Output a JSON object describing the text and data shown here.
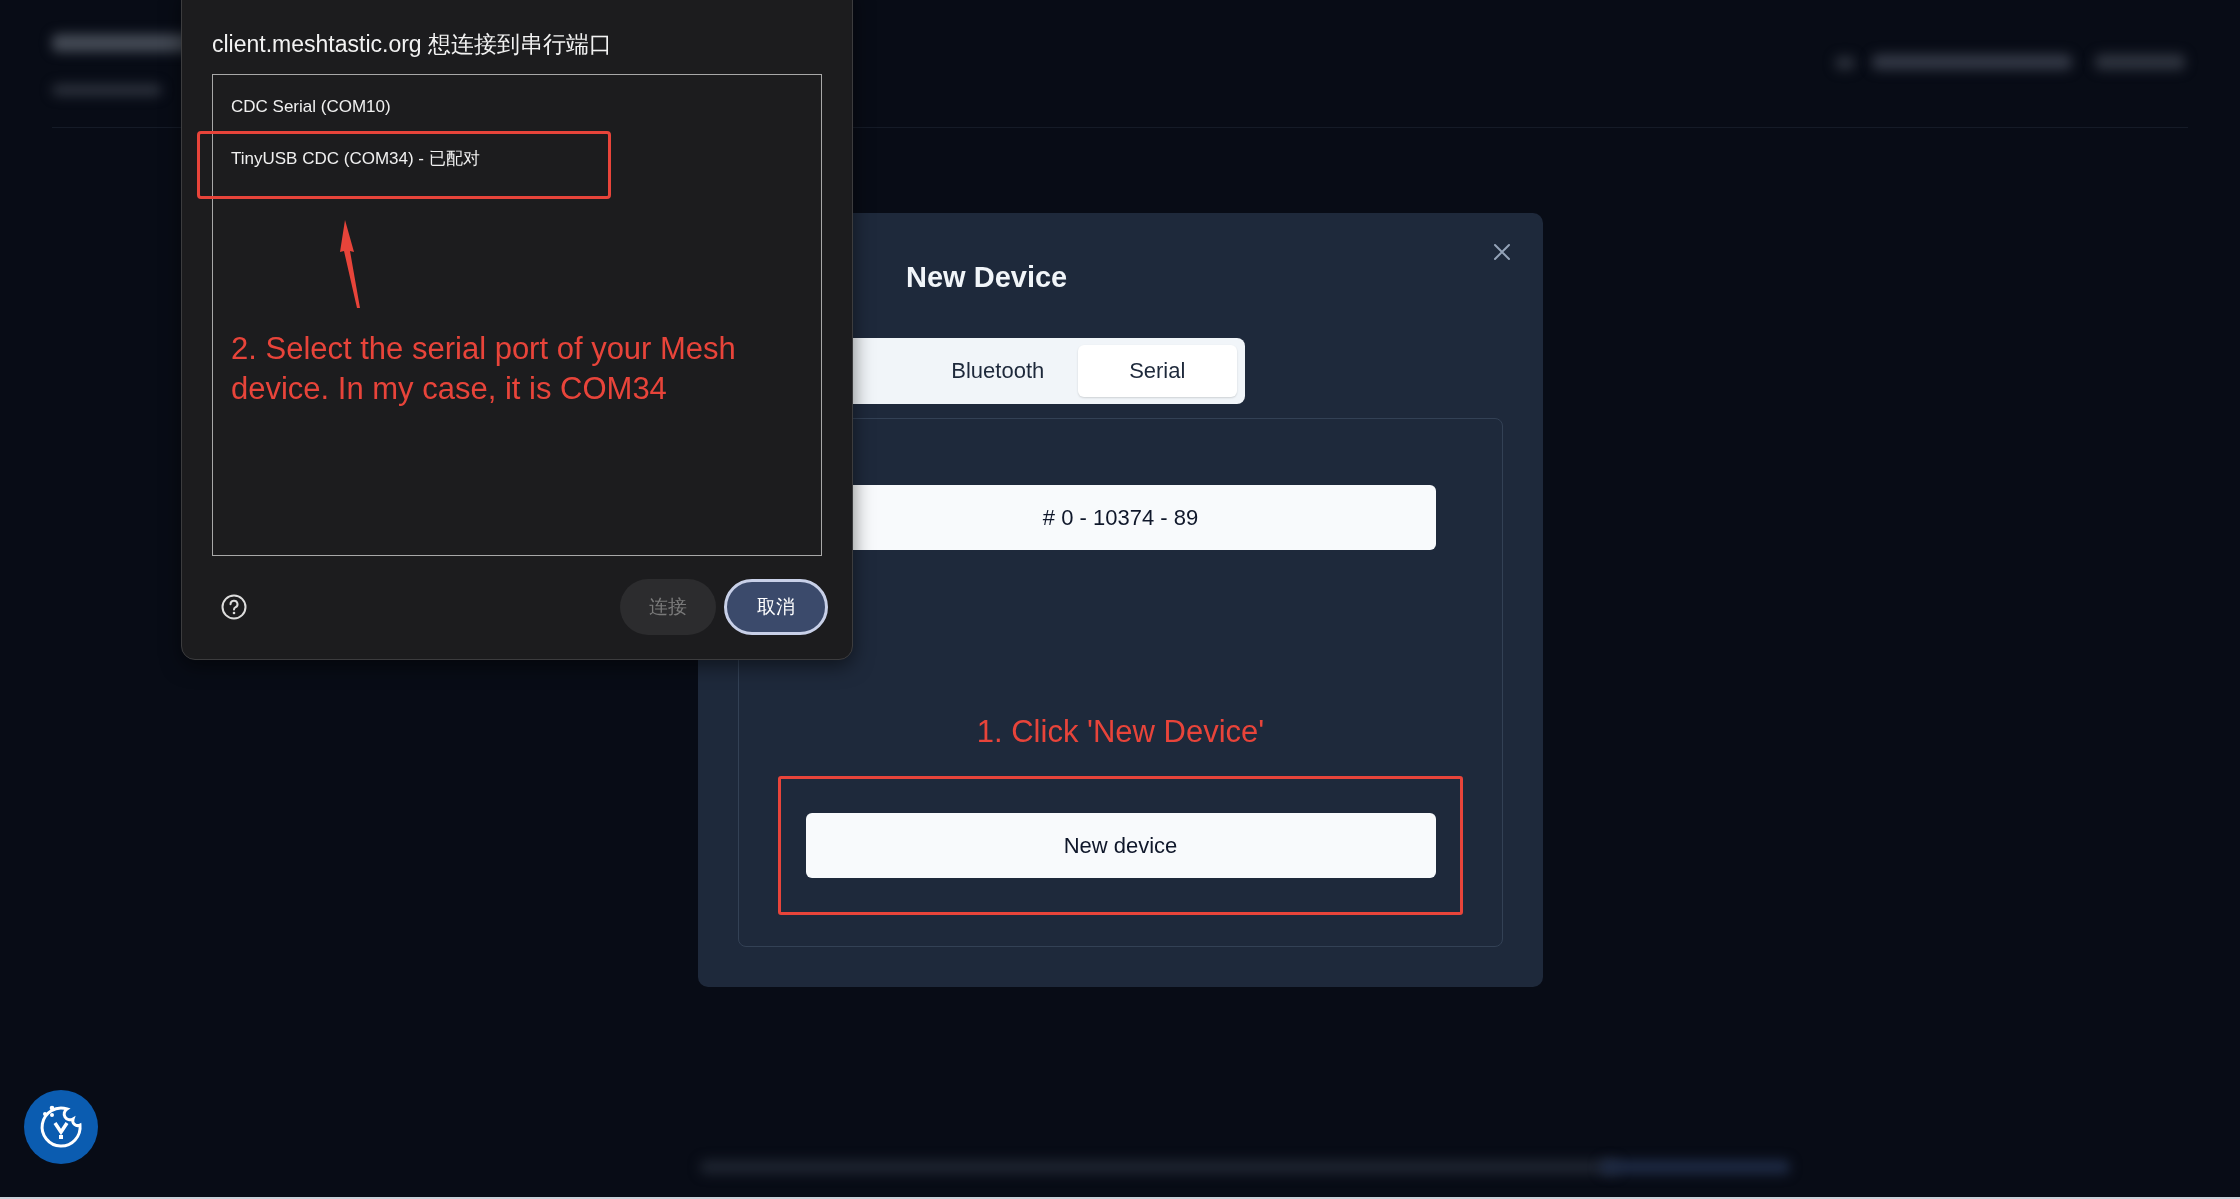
{
  "serial_prompt": {
    "title": "client.meshtastic.org 想连接到串行端口",
    "ports": [
      {
        "label": "CDC Serial (COM10)",
        "selected": false
      },
      {
        "label": "TinyUSB CDC (COM34) - 已配对",
        "selected": false
      }
    ],
    "buttons": [
      {
        "label": "连接",
        "kind": "connect",
        "disabled": true
      },
      {
        "label": "取消",
        "kind": "cancel",
        "disabled": false
      }
    ]
  },
  "connect_dialog": {
    "title": "New Device",
    "tabs": [
      {
        "label": "Bluetooth",
        "selected": false
      },
      {
        "label": "Serial",
        "selected": true
      }
    ],
    "devices": [
      "# 0 - 10374 - 89"
    ],
    "new_device_button": "New device"
  },
  "annotations": [
    {
      "kind": "port-note",
      "text": "2. Select the serial port of your Mesh device. In my case, it is COM34"
    },
    {
      "kind": "button-note",
      "text": "1. Click 'New Device'"
    }
  ]
}
